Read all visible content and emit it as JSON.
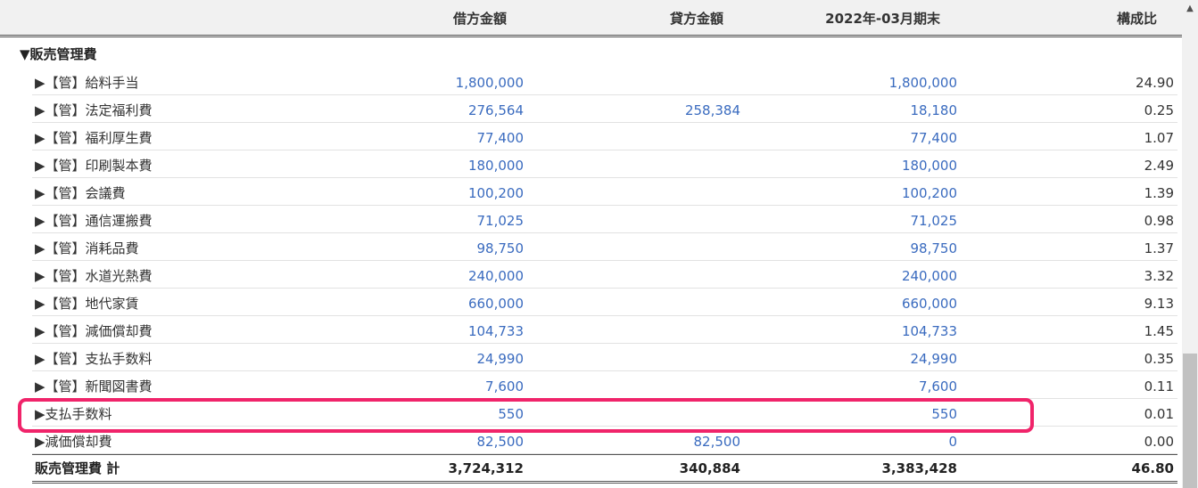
{
  "columns": {
    "debit": "借方金額",
    "credit": "貸方金額",
    "period_end": "2022年-03月期末",
    "ratio": "構成比"
  },
  "section": "▼販売管理費",
  "rows": [
    {
      "label": "▶【管】給料手当",
      "debit": "1,800,000",
      "credit": "",
      "end": "1,800,000",
      "ratio": "24.90"
    },
    {
      "label": "▶【管】法定福利費",
      "debit": "276,564",
      "credit": "258,384",
      "end": "18,180",
      "ratio": "0.25"
    },
    {
      "label": "▶【管】福利厚生費",
      "debit": "77,400",
      "credit": "",
      "end": "77,400",
      "ratio": "1.07"
    },
    {
      "label": "▶【管】印刷製本費",
      "debit": "180,000",
      "credit": "",
      "end": "180,000",
      "ratio": "2.49"
    },
    {
      "label": "▶【管】会議費",
      "debit": "100,200",
      "credit": "",
      "end": "100,200",
      "ratio": "1.39"
    },
    {
      "label": "▶【管】通信運搬費",
      "debit": "71,025",
      "credit": "",
      "end": "71,025",
      "ratio": "0.98"
    },
    {
      "label": "▶【管】消耗品費",
      "debit": "98,750",
      "credit": "",
      "end": "98,750",
      "ratio": "1.37"
    },
    {
      "label": "▶【管】水道光熱費",
      "debit": "240,000",
      "credit": "",
      "end": "240,000",
      "ratio": "3.32"
    },
    {
      "label": "▶【管】地代家賃",
      "debit": "660,000",
      "credit": "",
      "end": "660,000",
      "ratio": "9.13"
    },
    {
      "label": "▶【管】減価償却費",
      "debit": "104,733",
      "credit": "",
      "end": "104,733",
      "ratio": "1.45"
    },
    {
      "label": "▶【管】支払手数料",
      "debit": "24,990",
      "credit": "",
      "end": "24,990",
      "ratio": "0.35"
    },
    {
      "label": "▶【管】新聞図書費",
      "debit": "7,600",
      "credit": "",
      "end": "7,600",
      "ratio": "0.11"
    },
    {
      "label": "▶支払手数料",
      "debit": "550",
      "credit": "",
      "end": "550",
      "ratio": "0.01"
    },
    {
      "label": "▶減価償却費",
      "debit": "82,500",
      "credit": "82,500",
      "end": "0",
      "ratio": "0.00"
    }
  ],
  "total": {
    "label": "販売管理費 計",
    "debit": "3,724,312",
    "credit": "340,884",
    "end": "3,383,428",
    "ratio": "46.80"
  },
  "scroll_up_icon": "▲",
  "colors": {
    "amount_link": "#3a6bbf",
    "highlight": "#f0246a"
  }
}
